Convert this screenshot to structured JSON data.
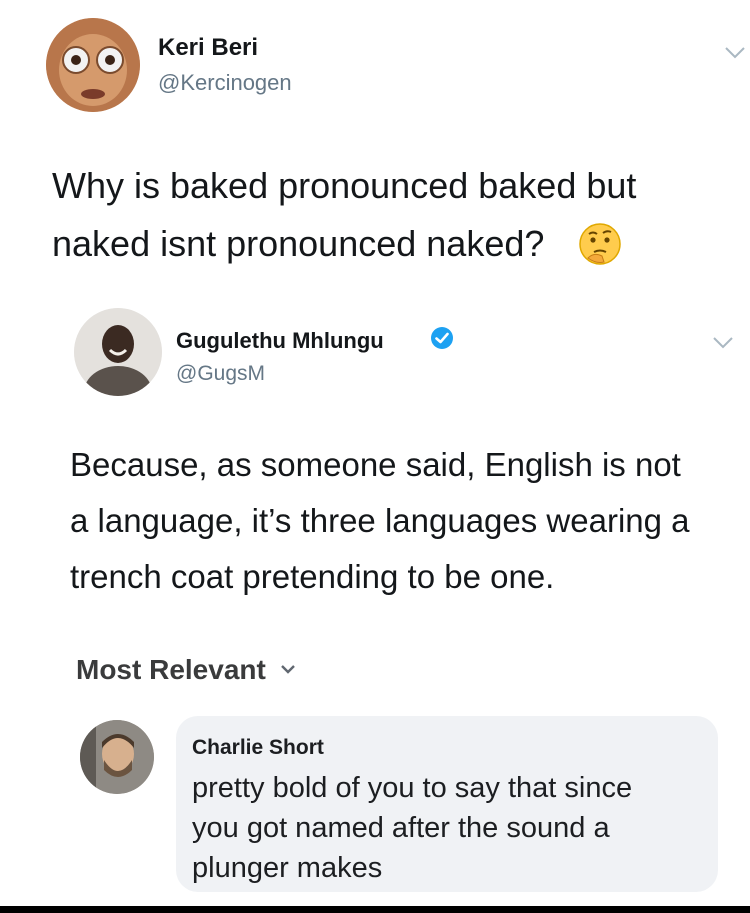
{
  "tweet1": {
    "name": "Keri Beri",
    "handle": "@Kercinogen",
    "line1": "Why is baked pronounced baked but",
    "line2": "naked isnt pronounced naked?",
    "emoji": "thinking-face-icon"
  },
  "tweet2": {
    "name": "Gugulethu Mhlungu",
    "handle": "@GugsM",
    "verified": true,
    "line1": "Because, as someone said, English is not",
    "line2": "a language, it’s three languages wearing a",
    "line3": "trench coat pretending to be one."
  },
  "sort": {
    "label": "Most Relevant"
  },
  "comment": {
    "name": "Charlie Short",
    "line1": "pretty bold of you to say that since",
    "line2": "you got named after the sound a",
    "line3": "plunger makes"
  },
  "colors": {
    "verified": "#1da1f2",
    "bubble": "#f0f2f5"
  }
}
